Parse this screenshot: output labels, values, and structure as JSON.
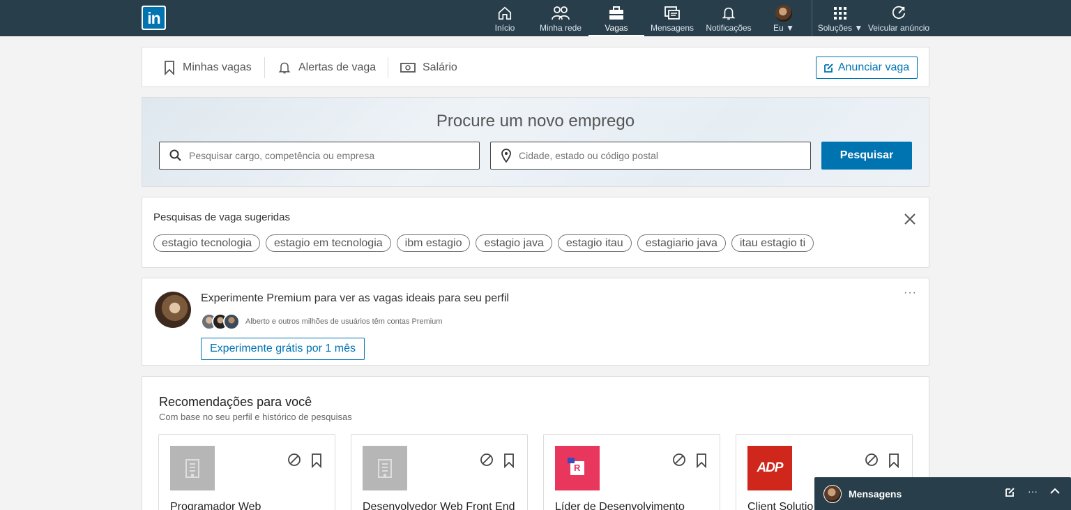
{
  "nav": {
    "logo": "in",
    "items": [
      {
        "label": "Início",
        "icon": "home-icon"
      },
      {
        "label": "Minha rede",
        "icon": "network-icon"
      },
      {
        "label": "Vagas",
        "icon": "briefcase-icon",
        "active": true
      },
      {
        "label": "Mensagens",
        "icon": "messages-icon"
      },
      {
        "label": "Notificações",
        "icon": "bell-icon"
      },
      {
        "label": "Eu",
        "icon": "avatar"
      },
      {
        "label": "Soluções",
        "icon": "grid-icon"
      },
      {
        "label": "Veicular anúncio",
        "icon": "ad-icon"
      }
    ]
  },
  "subnav": {
    "my_jobs": "Minhas vagas",
    "job_alerts": "Alertas de vaga",
    "salary": "Salário",
    "post_job": "Anunciar vaga"
  },
  "search": {
    "title": "Procure um novo emprego",
    "keyword_placeholder": "Pesquisar cargo, competência ou empresa",
    "location_placeholder": "Cidade, estado ou código postal",
    "button": "Pesquisar"
  },
  "suggested": {
    "title": "Pesquisas de vaga sugeridas",
    "pills": [
      "estagio tecnologia",
      "estagio em tecnologia",
      "ibm estagio",
      "estagio java",
      "estagio itau",
      "estagiario java",
      "itau estagio ti"
    ]
  },
  "premium": {
    "title": "Experimente Premium para ver as vagas ideais para seu perfil",
    "subtitle": "Alberto e outros milhões de usuários têm contas Premium",
    "button": "Experimente grátis por 1 mês",
    "more": "···"
  },
  "recommendations": {
    "title": "Recomendações para você",
    "subtitle": "Com base no seu perfil e histórico de pesquisas",
    "jobs": [
      {
        "title": "Programador Web",
        "logo": "building-icon",
        "logo_color": "#b6b6b6"
      },
      {
        "title": "Desenvolvedor Web Front End",
        "logo": "building-icon",
        "logo_color": "#b6b6b6"
      },
      {
        "title": "Líder de Desenvolvimento",
        "logo": "R",
        "logo_color": "#e8365d"
      },
      {
        "title": "Client Solutio",
        "logo": "ADP",
        "logo_color": "#d0271d"
      }
    ]
  },
  "messaging": {
    "label": "Mensagens",
    "more": "···"
  },
  "colors": {
    "nav_bg": "#283e4a",
    "accent": "#0073b1"
  }
}
